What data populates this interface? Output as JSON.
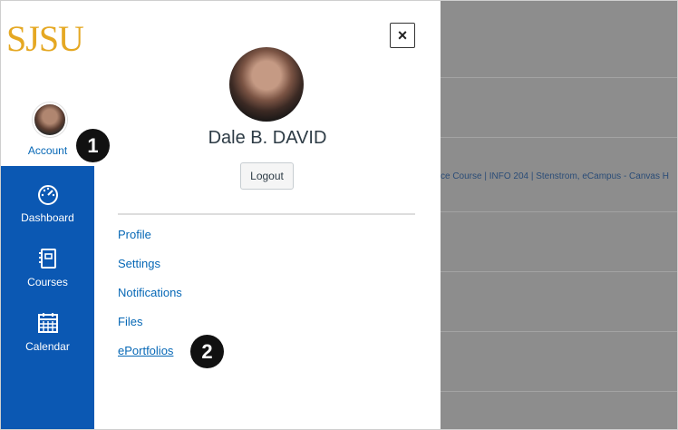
{
  "brand": {
    "logo_text": "SJSU",
    "logo_color": "#e5a823",
    "nav_blue": "#0b58b3",
    "link_color": "#0768b6"
  },
  "nav": {
    "account_label": "Account",
    "items": [
      {
        "label": "Dashboard",
        "icon": "dashboard-gauge-icon"
      },
      {
        "label": "Courses",
        "icon": "courses-book-icon"
      },
      {
        "label": "Calendar",
        "icon": "calendar-icon"
      }
    ]
  },
  "tray": {
    "close_symbol": "×",
    "user_name": "Dale B. DAVID",
    "logout_label": "Logout",
    "links": [
      "Profile",
      "Settings",
      "Notifications",
      "Files",
      "ePortfolios"
    ]
  },
  "background": {
    "course_crumb": "ce Course | INFO 204 | Stenstrom, eCampus - Canvas H"
  },
  "callouts": [
    "1",
    "2"
  ]
}
